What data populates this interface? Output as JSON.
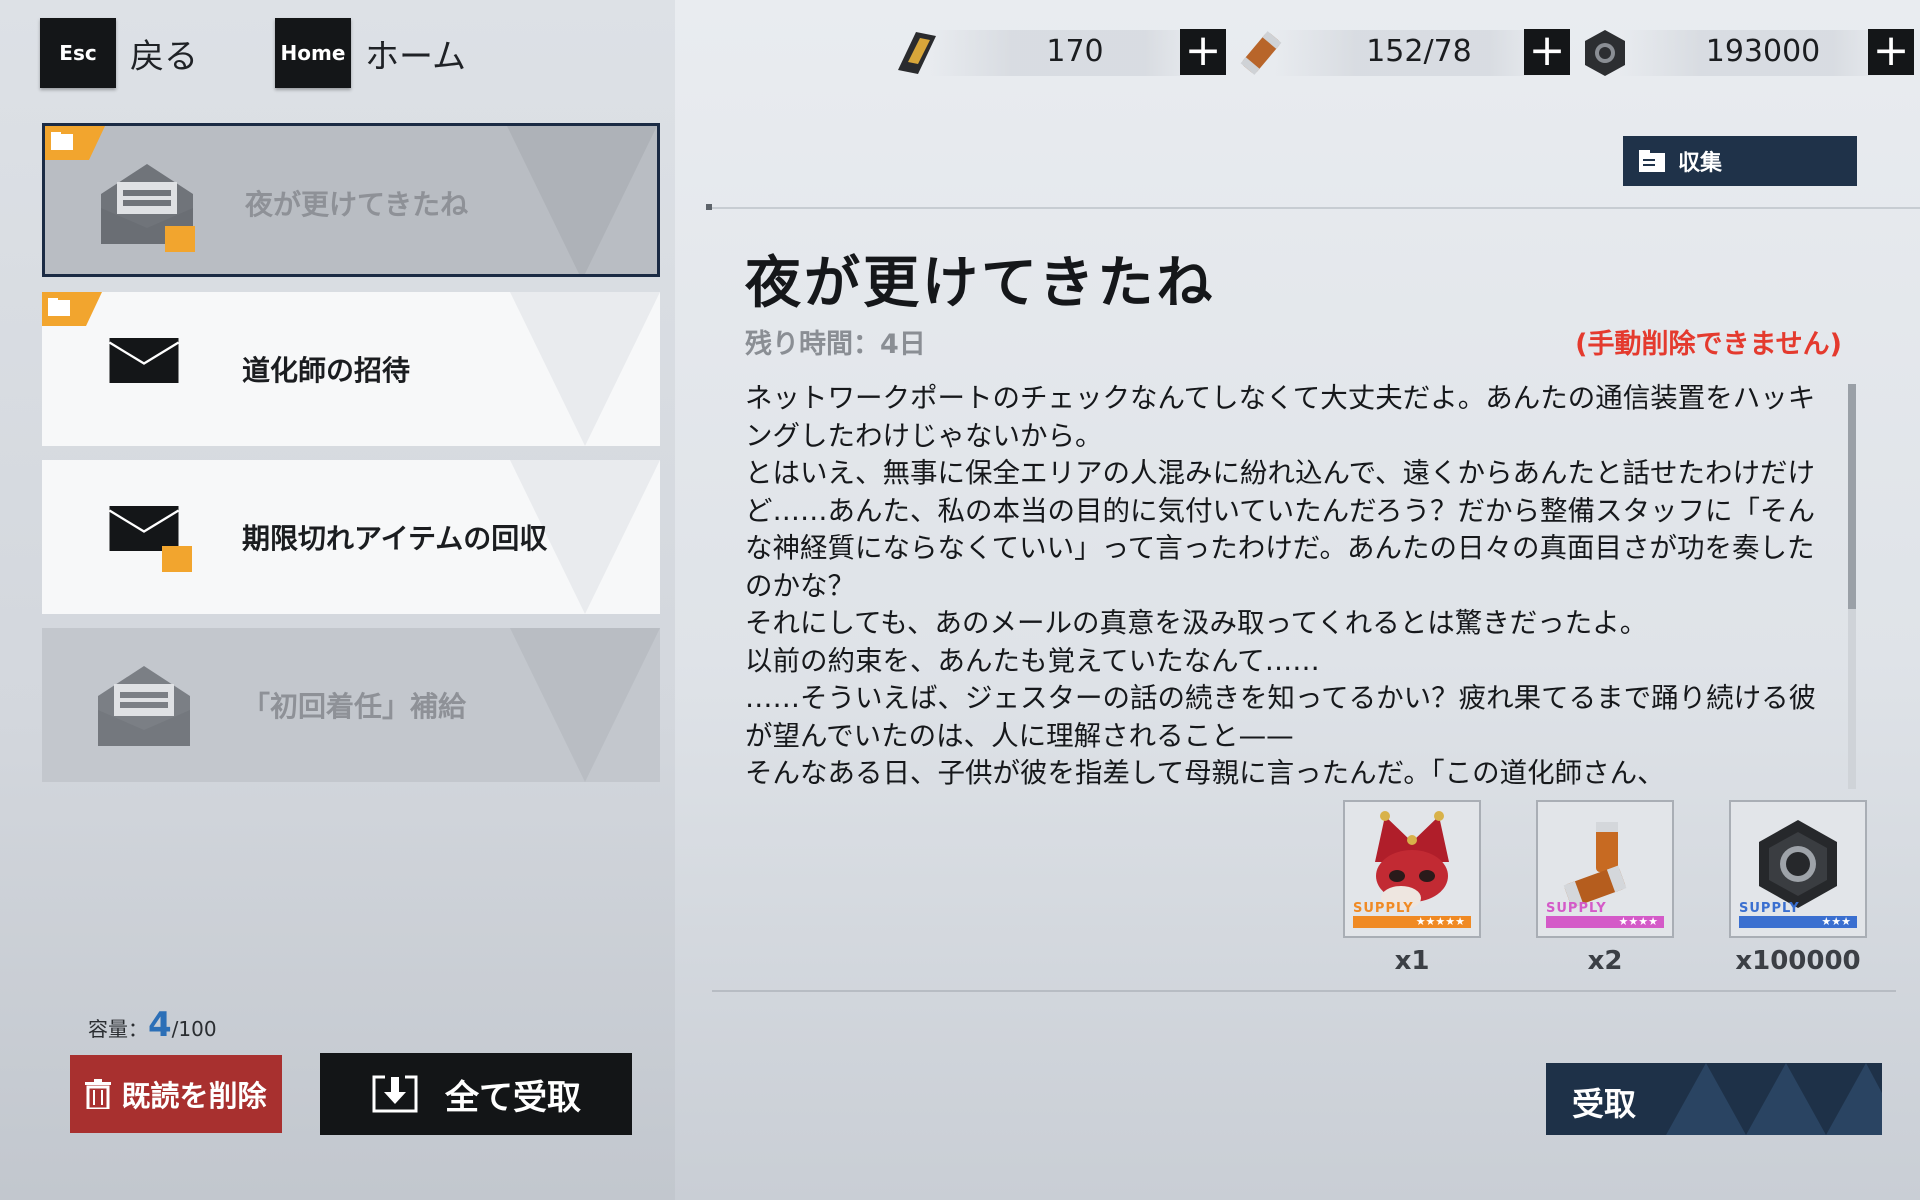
{
  "nav": {
    "back_key": "Esc",
    "back_label": "戻る",
    "home_key": "Home",
    "home_label": "ホーム"
  },
  "currencies": [
    {
      "icon": "gold-ticket-icon",
      "value": "170"
    },
    {
      "icon": "battery-capsule-icon",
      "value": "152/78"
    },
    {
      "icon": "hex-nut-icon",
      "value": "193000"
    }
  ],
  "mail_list": [
    {
      "title": "夜が更けてきたね",
      "state": "selected",
      "has_tag": true,
      "has_attachment": true,
      "opened": true
    },
    {
      "title": "道化師の招待",
      "state": "unread",
      "has_tag": true,
      "has_attachment": false,
      "opened": false
    },
    {
      "title": "期限切れアイテムの回収",
      "state": "unread",
      "has_tag": false,
      "has_attachment": true,
      "opened": false
    },
    {
      "title": "「初回着任」補給",
      "state": "read",
      "has_tag": false,
      "has_attachment": false,
      "opened": true
    }
  ],
  "capacity": {
    "label": "容量：",
    "current": "4",
    "max": "/100"
  },
  "buttons": {
    "delete_read": "既読を削除",
    "claim_all": "全て受取",
    "collect": "収集",
    "receive": "受取"
  },
  "detail": {
    "title": "夜が更けてきたね",
    "remaining": "残り時間：4日",
    "warning": "(手動削除できません)",
    "body": "ネットワークポートのチェックなんてしなくて大丈夫だよ。あんたの通信装置をハッキングしたわけじゃないから。\nとはいえ、無事に保全エリアの人混みに紛れ込んで、遠くからあんたと話せたわけだけど……あんた、私の本当の目的に気付いていたんだろう？だから整備スタッフに「そんな神経質にならなくていい」って言ったわけだ。あんたの日々の真面目さが功を奏したのかな？\nそれにしても、あのメールの真意を汲み取ってくれるとは驚きだったよ。\n以前の約束を、あんたも覚えていたなんて……\n……そういえば、ジェスターの話の続きを知ってるかい？疲れ果てるまで踊り続ける彼が望んでいたのは、人に理解されること——\nそんなある日、子供が彼を指差して母親に言ったんだ。「この道化師さん、"
  },
  "rewards": [
    {
      "icon": "jester-mask-icon",
      "tag": "SUPPLY",
      "stars": "★★★★★",
      "qty": "x1",
      "color": "#f08a24"
    },
    {
      "icon": "battery-capsule-icon",
      "tag": "SUPPLY",
      "stars": "★★★★",
      "qty": "x2",
      "color": "#d45ac8"
    },
    {
      "icon": "hex-nut-icon",
      "tag": "SUPPLY",
      "stars": "★★★",
      "qty": "x100000",
      "color": "#3a6fd0"
    }
  ]
}
